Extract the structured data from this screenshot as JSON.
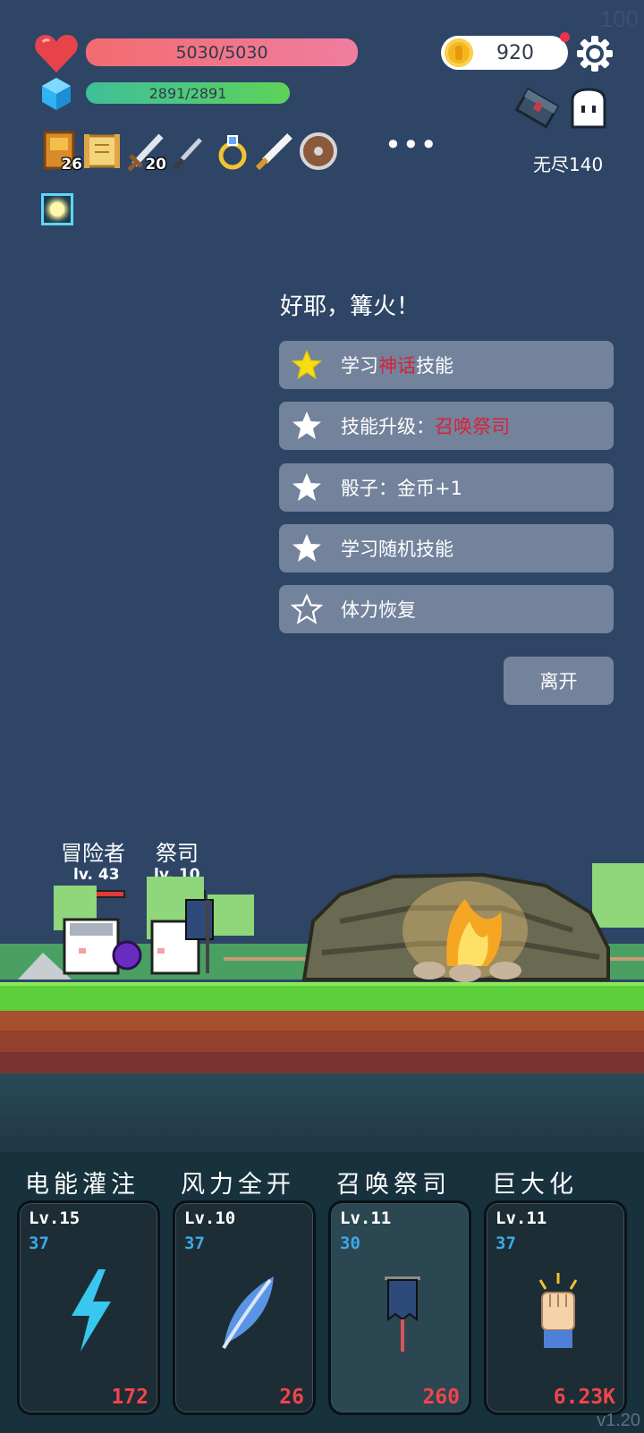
{
  "hud": {
    "fps": "100",
    "hp_text": "5030/5030",
    "hp_fraction": 1.0,
    "mp_text": "2891/2891",
    "mp_fraction": 1.0,
    "gold": "920",
    "mode_label": "无尽140",
    "inventory": [
      {
        "icon": "spellbook-icon",
        "count": "26"
      },
      {
        "icon": "scroll-icon",
        "count": ""
      },
      {
        "icon": "sword-icon",
        "count": "20"
      },
      {
        "icon": "dagger-icon",
        "count": ""
      },
      {
        "icon": "ring-icon",
        "count": ""
      },
      {
        "icon": "short-sword-icon",
        "count": ""
      },
      {
        "icon": "round-shield-icon",
        "count": ""
      }
    ],
    "more_label": "•••",
    "colors": {
      "hp": "#f26c70",
      "mp": "#5ed258",
      "gold": "#f5b71f",
      "background": "#2e4566"
    }
  },
  "event": {
    "title": "好耶，篝火！",
    "options": [
      {
        "prefix": "学习",
        "highlight": "神话",
        "suffix": "技能",
        "star": "gold"
      },
      {
        "prefix": "技能升级：",
        "highlight": "召唤祭司",
        "suffix": "",
        "star": "white"
      },
      {
        "prefix": "骰子：金币+1",
        "highlight": "",
        "suffix": "",
        "star": "white"
      },
      {
        "prefix": "学习随机技能",
        "highlight": "",
        "suffix": "",
        "star": "white"
      },
      {
        "prefix": "体力恢复",
        "highlight": "",
        "suffix": "",
        "star": "outline"
      }
    ],
    "leave_label": "离开",
    "highlight_color": "#d8213a"
  },
  "characters": [
    {
      "name": "冒险者",
      "level": "lv. 43"
    },
    {
      "name": "祭司",
      "level": "lv. 10"
    }
  ],
  "skills": [
    {
      "name": "电能灌注",
      "level": "Lv.15",
      "cooldown": "37",
      "cost": "172",
      "icon": "lightning-icon"
    },
    {
      "name": "风力全开",
      "level": "Lv.10",
      "cooldown": "37",
      "cost": "26",
      "icon": "feather-icon"
    },
    {
      "name": "召唤祭司",
      "level": "Lv.11",
      "cooldown": "30",
      "cost": "260",
      "icon": "banner-icon"
    },
    {
      "name": "巨大化",
      "level": "Lv.11",
      "cooldown": "37",
      "cost": "6.23K",
      "icon": "fist-icon"
    }
  ],
  "version": "v1.20"
}
